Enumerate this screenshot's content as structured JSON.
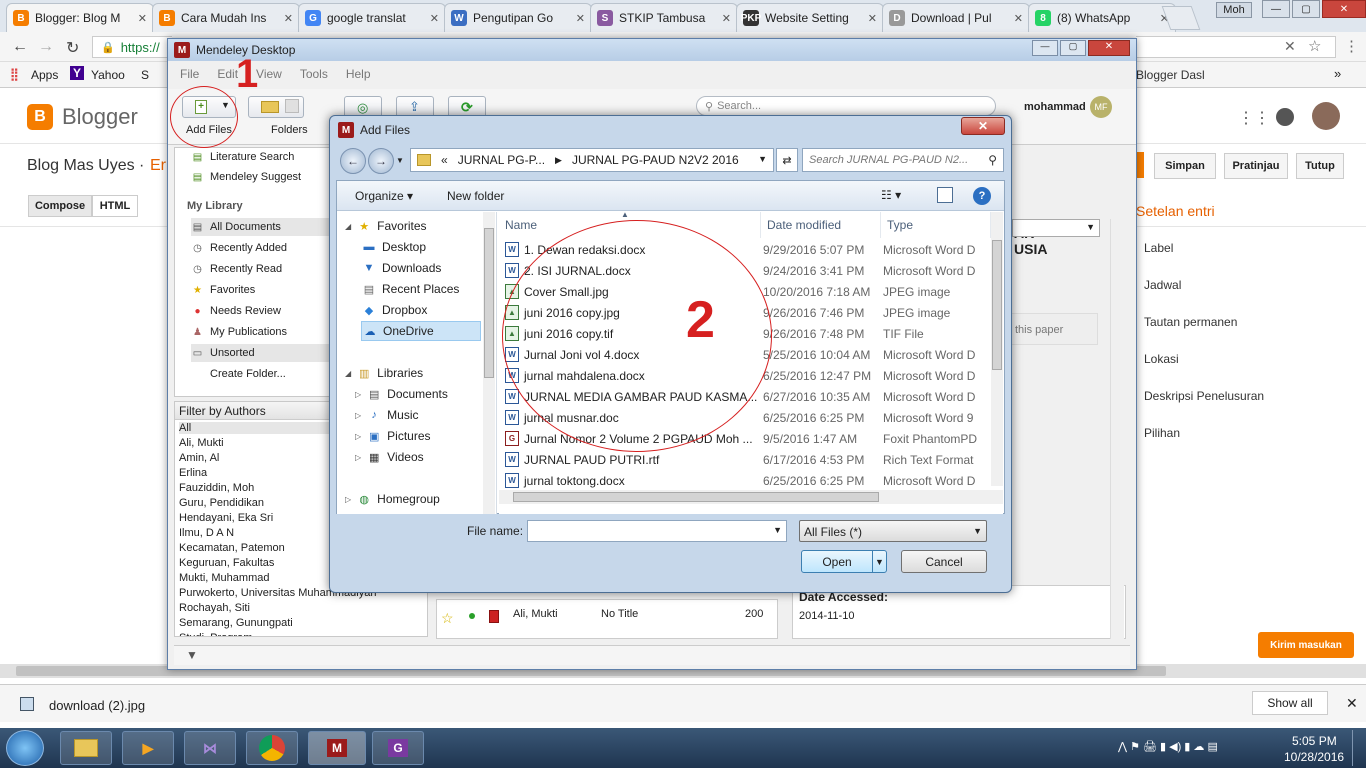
{
  "browser": {
    "tabs": [
      {
        "title": "Blogger: Blog M",
        "icon": "B",
        "color": "#f57d00"
      },
      {
        "title": "Cara Mudah Ins",
        "icon": "B",
        "color": "#f57d00"
      },
      {
        "title": "google translat",
        "icon": "G",
        "color": "#4285f4"
      },
      {
        "title": "Pengutipan Go",
        "icon": "W",
        "color": "#3b6ec2"
      },
      {
        "title": "STKIP Tambusa",
        "icon": "S",
        "color": "#8a5aa0"
      },
      {
        "title": "Website Setting",
        "icon": "PKP",
        "color": "#333333"
      },
      {
        "title": "Download | Pul",
        "icon": "D",
        "color": "#999999"
      },
      {
        "title": "(8) WhatsApp",
        "icon": "8",
        "color": "#25d366"
      }
    ],
    "user": "Moh",
    "url": "https://",
    "bookmarks": {
      "apps": "Apps",
      "yahoo": "Yahoo",
      "s": "S",
      "right": "Blogger Dasl"
    }
  },
  "blogger": {
    "logo": "Blogger",
    "blog_title": "Blog Mas Uyes ·",
    "blog_title_2": "Er",
    "compose": "Compose",
    "html": "HTML",
    "buttons": {
      "save": "Simpan",
      "preview": "Pratinjau",
      "close": "Tutup"
    },
    "settings_title": "Setelan entri",
    "settings": [
      "Label",
      "Jadwal",
      "Tautan permanen",
      "Lokasi",
      "Deskripsi Penelusuran",
      "Pilihan"
    ],
    "feedback": "Kirim masukan",
    "doc_text_1": "AK",
    "doc_text_2": "USIA",
    "this_paper": "this paper",
    "date_accessed": "Date Accessed:",
    "date_value": "2014-11-10"
  },
  "mendeley": {
    "title": "Mendeley Desktop",
    "menus": [
      "File",
      "Edit",
      "View",
      "Tools",
      "Help"
    ],
    "toolbar": {
      "add_files": "Add Files",
      "folders": "Folders"
    },
    "search_placeholder": "Search...",
    "user_name": "mohammad",
    "user_initials": "MF",
    "sidebar_top": [
      "Literature Search",
      "Mendeley Suggest"
    ],
    "my_library": "My Library",
    "library_items": [
      "All Documents",
      "Recently Added",
      "Recently Read",
      "Favorites",
      "Needs Review",
      "My Publications",
      "Unsorted",
      "Create Folder..."
    ],
    "filter_title": "Filter by Authors",
    "authors": [
      "All",
      "Ali, Mukti",
      "Amin, Al",
      "Erlina",
      "Fauziddin, Moh",
      "Guru, Pendidikan",
      "Hendayani, Eka Sri",
      "Ilmu, D A N",
      "Kecamatan, Patemon",
      "Keguruan, Fakultas",
      "Mukti, Muhammad",
      "Purwokerto, Universitas Muhammadiyah",
      "Rochayah, Siti",
      "Semarang, Gunungpati",
      "Studi, Program"
    ],
    "doc_row": {
      "author": "Ali, Mukti",
      "title": "No Title",
      "year": "200"
    }
  },
  "dialog": {
    "title": "Add Files",
    "breadcrumb": [
      "«",
      "JURNAL PG-P...",
      "JURNAL  PG-PAUD N2V2 2016"
    ],
    "search_placeholder": "Search JURNAL  PG-PAUD N2...",
    "organize": "Organize",
    "new_folder": "New folder",
    "nav": {
      "favorites": "Favorites",
      "favorites_items": [
        "Desktop",
        "Downloads",
        "Recent Places",
        "Dropbox",
        "OneDrive"
      ],
      "libraries": "Libraries",
      "libraries_items": [
        "Documents",
        "Music",
        "Pictures",
        "Videos"
      ],
      "homegroup": "Homegroup"
    },
    "columns": {
      "name": "Name",
      "date": "Date modified",
      "type": "Type"
    },
    "files": [
      {
        "name": "1. Dewan redaksi.docx",
        "date": "9/29/2016 5:07 PM",
        "type": "Microsoft Word D",
        "kind": "W"
      },
      {
        "name": "2. ISI JURNAL.docx",
        "date": "9/24/2016 3:41 PM",
        "type": "Microsoft Word D",
        "kind": "W"
      },
      {
        "name": "Cover Small.jpg",
        "date": "10/20/2016 7:18 AM",
        "type": "JPEG image",
        "kind": "img"
      },
      {
        "name": "juni 2016 copy.jpg",
        "date": "9/26/2016 7:46 PM",
        "type": "JPEG image",
        "kind": "img"
      },
      {
        "name": "juni 2016 copy.tif",
        "date": "9/26/2016 7:48 PM",
        "type": "TIF File",
        "kind": "img"
      },
      {
        "name": "Jurnal Joni vol 4.docx",
        "date": "5/25/2016 10:04 AM",
        "type": "Microsoft Word D",
        "kind": "W"
      },
      {
        "name": "jurnal mahdalena.docx",
        "date": "6/25/2016 12:47 PM",
        "type": "Microsoft Word D",
        "kind": "W"
      },
      {
        "name": "JURNAL MEDIA GAMBAR PAUD KASMA...",
        "date": "6/27/2016 10:35 AM",
        "type": "Microsoft Word D",
        "kind": "W"
      },
      {
        "name": "jurnal musnar.doc",
        "date": "6/25/2016 6:25 PM",
        "type": "Microsoft Word 9",
        "kind": "W"
      },
      {
        "name": "Jurnal Nomor 2 Volume 2 PGPAUD Moh ...",
        "date": "9/5/2016 1:47 AM",
        "type": "Foxit PhantomPD",
        "kind": "pdf"
      },
      {
        "name": "JURNAL PAUD PUTRI.rtf",
        "date": "6/17/2016 4:53 PM",
        "type": "Rich Text Format",
        "kind": "W"
      },
      {
        "name": "jurnal toktong.docx",
        "date": "6/25/2016 6:25 PM",
        "type": "Microsoft Word D",
        "kind": "W"
      }
    ],
    "filename_label": "File name:",
    "filename_value": "",
    "filetype": "All Files  (*)",
    "open": "Open",
    "cancel": "Cancel"
  },
  "annotations": {
    "one": "1",
    "two": "2"
  },
  "downloads": {
    "file": "download (2).jpg",
    "show_all": "Show all"
  },
  "taskbar": {
    "time": "5:05 PM",
    "date": "10/28/2016"
  }
}
